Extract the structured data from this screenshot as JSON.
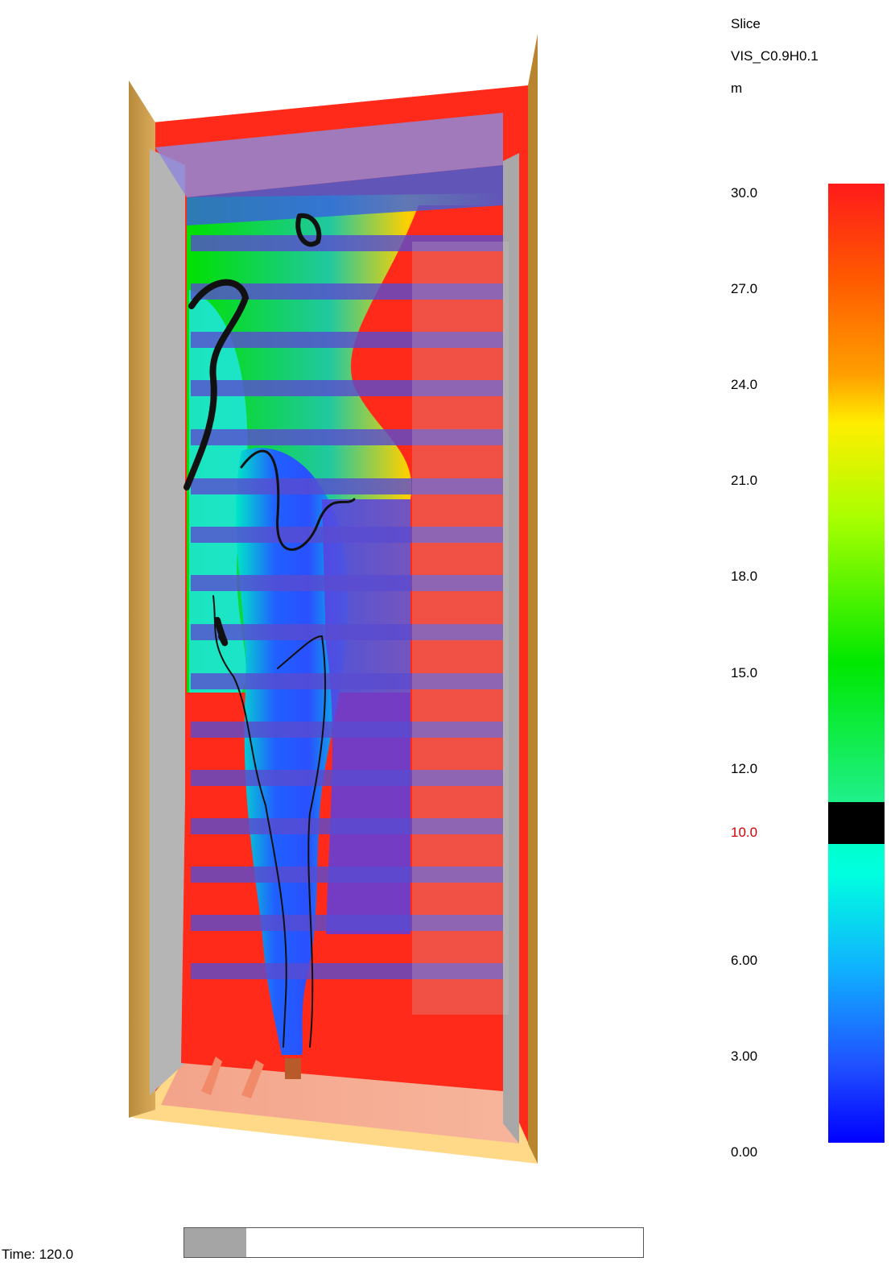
{
  "legend": {
    "slice_label": "Slice",
    "quantity": "VIS_C0.9H0.1",
    "unit": "m",
    "ticks": [
      "30.0",
      "27.0",
      "24.0",
      "21.0",
      "18.0",
      "15.0",
      "12.0",
      "10.0",
      "6.00",
      "3.00",
      "0.00"
    ],
    "tick_values": [
      30,
      27,
      24,
      21,
      18,
      15,
      12,
      10,
      6,
      3,
      0
    ],
    "highlight_value": "10.0",
    "range": [
      0,
      30
    ],
    "colors": {
      "max": "#ff1a1a",
      "high": "#ff8000",
      "mid_high": "#ffff00",
      "mid": "#00e000",
      "contour": "#000000",
      "low_mid": "#00ffd8",
      "low": "#0080ff",
      "min": "#0000ff",
      "highlight_text": "#d40000"
    }
  },
  "time": {
    "label": "Time: 120.0",
    "value": 120.0,
    "progress": 0.135
  },
  "scene": {
    "description_icon": "building-atrium-3d-view"
  }
}
